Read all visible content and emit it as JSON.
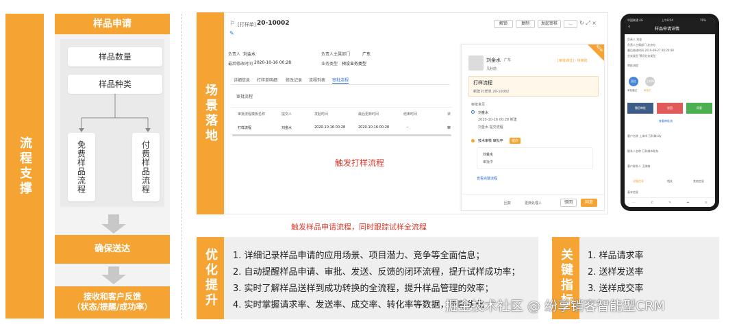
{
  "left_section": {
    "label": "流程支撑",
    "header": "样品申请",
    "items": [
      "样品数量",
      "样品种类"
    ],
    "branches": [
      "免费样品流程",
      "付费样品流程"
    ],
    "step_ensure": "确保送达",
    "step_feedback_line1": "接收和客户反馈",
    "step_feedback_line2": "（状态/提醒/成功率）"
  },
  "scene_section": {
    "label": "场景落地",
    "crm_screen": {
      "title_prefix": "[打样单]",
      "record_no": "20-10002",
      "toolbar": [
        "解锁",
        "复制",
        "发起审核",
        "..."
      ],
      "field_owner_label": "负责人",
      "field_owner": "刘金水",
      "field_dept_label": "负责人主属部门",
      "field_dept": "广东",
      "field_modified_label": "最后修改时间",
      "field_modified": "2020-10-16 00:28",
      "field_type_label": "业务类型",
      "field_type": "预设业务类型",
      "tabs": [
        "详细信息",
        "打样单明细",
        "修改记录",
        "流程列表",
        "审批流程"
      ],
      "section_title": "审批流程",
      "table_headers": [
        "审批流程模板名称",
        "提交人",
        "发起时间",
        "最后更新时间",
        "结束时间",
        "状"
      ],
      "table_row": [
        "打样流程",
        "刘金水",
        "2020-10-16 00:28",
        "2020-10-16 00:28",
        "--",
        "审"
      ],
      "caption": "触发打样流程"
    },
    "approval_panel": {
      "user": "刘金水",
      "user_dept": "广东",
      "user_role": "几秒前",
      "status": "[审批通过] · 待审批",
      "badge": "NEW",
      "flow_title": "打样流程",
      "flow_sub": "新建 打样单 20-10002",
      "log_title": "审批意见",
      "log1_name": "刘金水",
      "log1_time": "2020-10-16 00:28 新建",
      "log1_note": "刘金水 提交流程",
      "log2_title": "技术审核 审批中",
      "log2_tag": "催办",
      "log3_name": "刘金水",
      "log3_status": "审批中",
      "log_more": "查看完整流程",
      "footer_btns": [
        "回复",
        "更换处理人",
        "驳回",
        "同意"
      ]
    },
    "mobile": {
      "status_left": "中国联通 4G",
      "status_time": "上午8:54",
      "status_right": "76%",
      "title": "样品申请详情",
      "lines": [
        "负责人  刘金",
        "负责人主属部门  北京办",
        "最后修改时间  2019-09-27 00:20:48",
        "业务类型  预设业务类型"
      ],
      "section": "审批流程",
      "avatars": [
        "吴红",
        "王冬梅"
      ],
      "avatar_labels": [
        "审批通过",
        "审批中"
      ],
      "actions": [
        "撤回审批",
        "驳回",
        "同意"
      ],
      "link": "查看审批流",
      "info_rows": [
        "客户名称  上海市 万科城city",
        "联系人名称  万科城市联系",
        "客户联系人  王晓梅"
      ],
      "tabs": [
        "详细信息",
        "相关",
        "其他信息"
      ],
      "basic": "基本信息"
    },
    "red_caption": "触发样品申请流程，同时跟踪试样全流程"
  },
  "optimize_section": {
    "label": "优化提升",
    "items": [
      "1. 详细记录样品申请的应用场景、项目潜力、竞争等全面信息；",
      "2. 自动提醒样品申请、审批、发送、反馈的闭环流程，提升试样成功率；",
      "3. 实时了解样品送样到成功转换的全流程，提升样品管理的效率；",
      "4. 实时掌握请求率、发送率、成交率、转化率等数据，不断优化"
    ]
  },
  "kpi_section": {
    "label": "关键指标",
    "items": [
      "1. 样品请求率",
      "2. 送样发送率",
      "3. 送样成交率"
    ]
  },
  "watermark": "掘金技术社区 @ 纷享销客智能型CRM",
  "colors": {
    "orange": "#f5a433",
    "red": "#e03a2c",
    "blue": "#2d6fd1",
    "green": "#4caf50"
  }
}
